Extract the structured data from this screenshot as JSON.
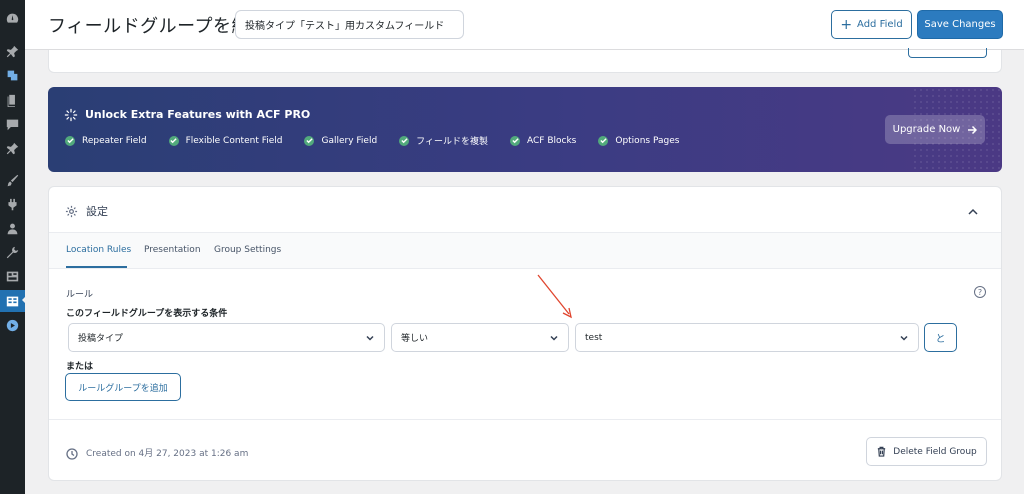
{
  "header": {
    "title": "フィールドグループを編集",
    "group_title_value": "投稿タイプ「テスト」用カスタムフィールド",
    "add_field_label": "Add Field",
    "save_label": "Save Changes"
  },
  "sidebar": {
    "icons": [
      "dashboard-icon",
      "pin-icon",
      "media-icon",
      "pages-icon",
      "comments-icon",
      "pin-icon",
      "appearance-icon",
      "plugins-icon",
      "users-icon",
      "tools-icon",
      "settings-icon",
      "acf-icon",
      "play-icon"
    ]
  },
  "promo": {
    "title": "Unlock Extra Features with ACF PRO",
    "features": [
      "Repeater Field",
      "Flexible Content Field",
      "Gallery Field",
      "フィールドを複製",
      "ACF Blocks",
      "Options Pages"
    ],
    "upgrade_label": "Upgrade Now"
  },
  "settings": {
    "title": "設定",
    "tabs": [
      "Location Rules",
      "Presentation",
      "Group Settings"
    ],
    "active_tab": "Location Rules",
    "rules_label": "ルール",
    "condition_label": "このフィールドグループを表示する条件",
    "rule": {
      "param": "投稿タイプ",
      "operator": "等しい",
      "value": "test",
      "and_label": "と"
    },
    "or_label": "または",
    "add_group_label": "ルールグループを追加",
    "help_label": "?",
    "created": "Created on 4月 27, 2023 at 1:26 am",
    "delete_label": "Delete Field Group"
  },
  "colors": {
    "accent": "#2c6e9f",
    "primary_button": "#2c7bbf",
    "promo_start": "#2a3e74",
    "promo_end": "#4b3984",
    "check": "#52aa7c",
    "annotation_arrow": "#e0452e"
  }
}
